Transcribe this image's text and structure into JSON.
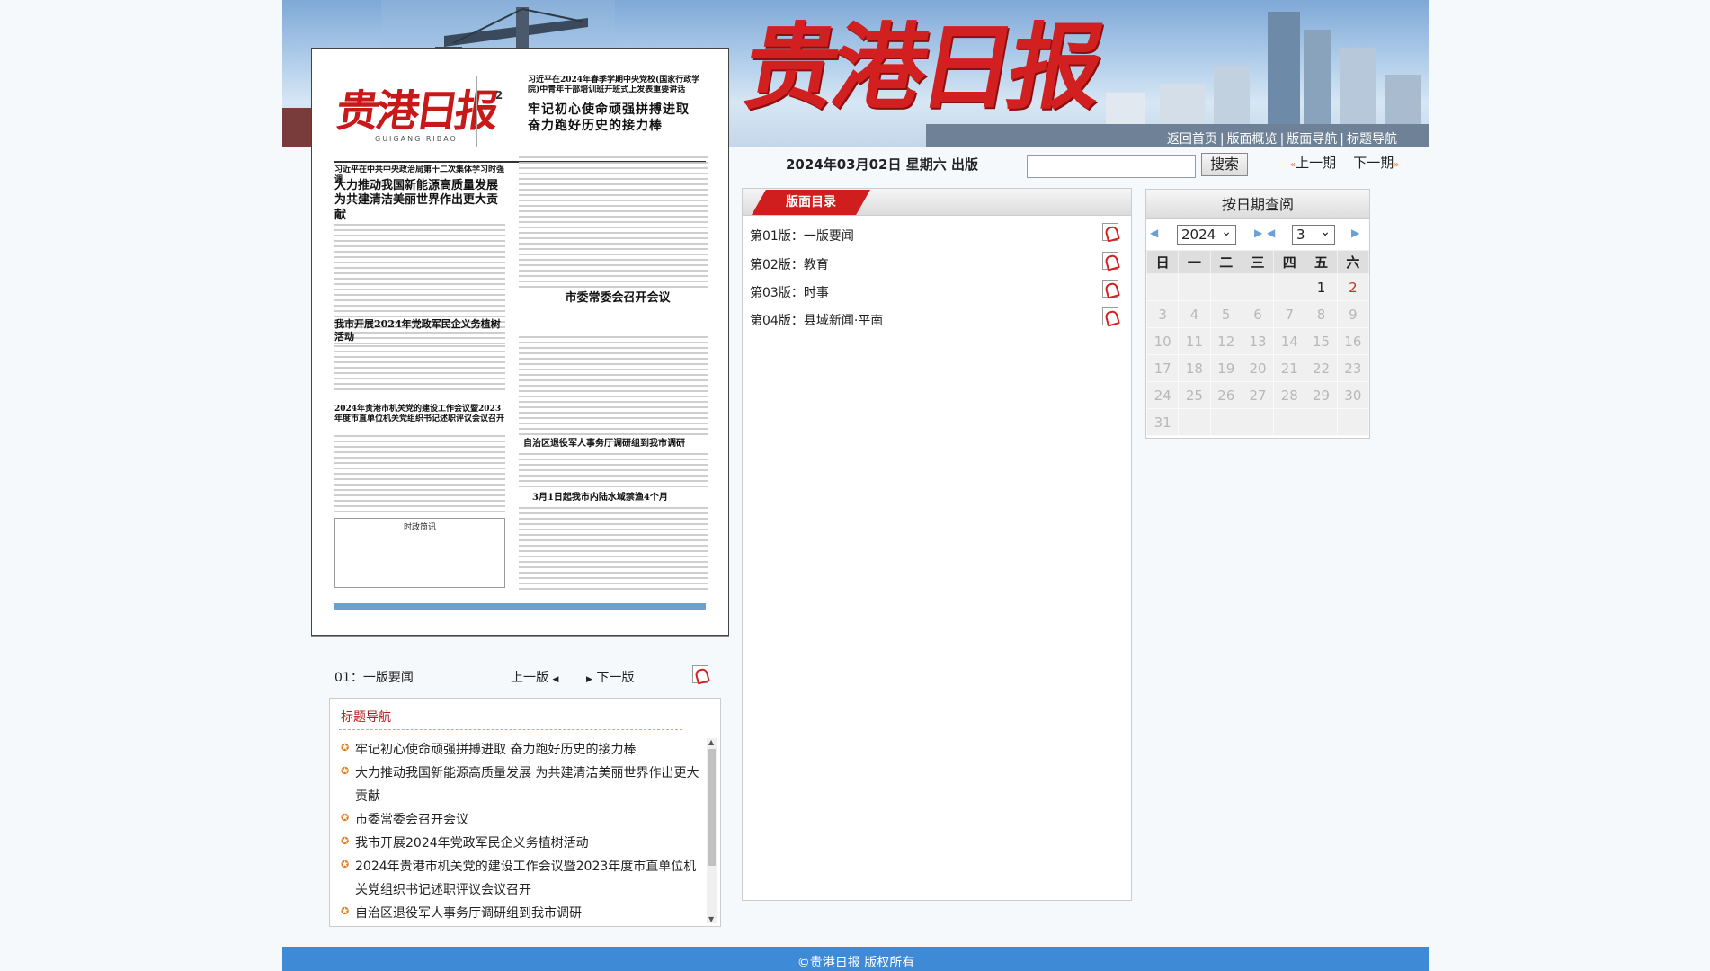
{
  "header": {
    "logo": "贵港日报",
    "nav": [
      "返回首页",
      "版面概览",
      "版面导航",
      "标题导航"
    ]
  },
  "paper_thumb": {
    "logo": "贵港日报",
    "logo_sub": "GUIGANG RIBAO",
    "issue_no": "2",
    "headlines": [
      "习近平在2024年春季学期中央党校(国家行政学院)中青年干部培训班开班式上发表重要讲话",
      "牢记初心使命顽强拼搏进取 奋力跑好历史的接力棒",
      "习近平在中共中央政治局第十二次集体学习时强调",
      "大力推动我国新能源高质量发展 为共建清洁美丽世界作出更大贡献",
      "市委常委会召开会议",
      "我市开展2024年党政军民企义务植树活动",
      "2024年贵港市机关党的建设工作会议暨2023年度市直单位机关党组织书记述职评议会议召开",
      "自治区退役军人事务厅调研组到我市调研",
      "3月1日起我市内陆水域禁渔4个月",
      "时政简讯"
    ]
  },
  "page_nav": {
    "current": "01：一版要闻",
    "prev": "上一版",
    "next": "下一版"
  },
  "title_nav": {
    "heading": "标题导航",
    "items": [
      "牢记初心使命顽强拼搏进取 奋力跑好历史的接力棒",
      "大力推动我国新能源高质量发展 为共建清洁美丽世界作出更大贡献",
      "市委常委会召开会议",
      "我市开展2024年党政军民企义务植树活动",
      "2024年贵港市机关党的建设工作会议暨2023年度市直单位机关党组织书记述职评议会议召开",
      "自治区退役军人事务厅调研组到我市调研"
    ]
  },
  "date_bar": {
    "date": "2024年03月02日 星期六 出版",
    "search_value": "",
    "search_button": "搜索",
    "prev_issue": "上一期",
    "next_issue": "下一期"
  },
  "directory": {
    "heading": "版面目录",
    "pages": [
      "第01版：一版要闻",
      "第02版：教育",
      "第03版：时事",
      "第04版：县域新闻·平南"
    ]
  },
  "calendar": {
    "heading": "按日期查阅",
    "year": "2024",
    "month": "3",
    "weekdays": [
      "日",
      "一",
      "二",
      "三",
      "四",
      "五",
      "六"
    ],
    "weeks": [
      [
        "",
        "",
        "",
        "",
        "",
        "1",
        "2"
      ],
      [
        "3",
        "4",
        "5",
        "6",
        "7",
        "8",
        "9"
      ],
      [
        "10",
        "11",
        "12",
        "13",
        "14",
        "15",
        "16"
      ],
      [
        "17",
        "18",
        "19",
        "20",
        "21",
        "22",
        "23"
      ],
      [
        "24",
        "25",
        "26",
        "27",
        "28",
        "29",
        "30"
      ],
      [
        "31",
        "",
        "",
        "",
        "",
        "",
        ""
      ]
    ],
    "available": [
      "1"
    ],
    "selected": "2"
  },
  "footer": {
    "copyright": "©贵港日报 版权所有"
  },
  "colors": {
    "brand_red": "#d21f1f",
    "footer_blue": "#3e8ad6",
    "accent_orange": "#e07b1a"
  }
}
